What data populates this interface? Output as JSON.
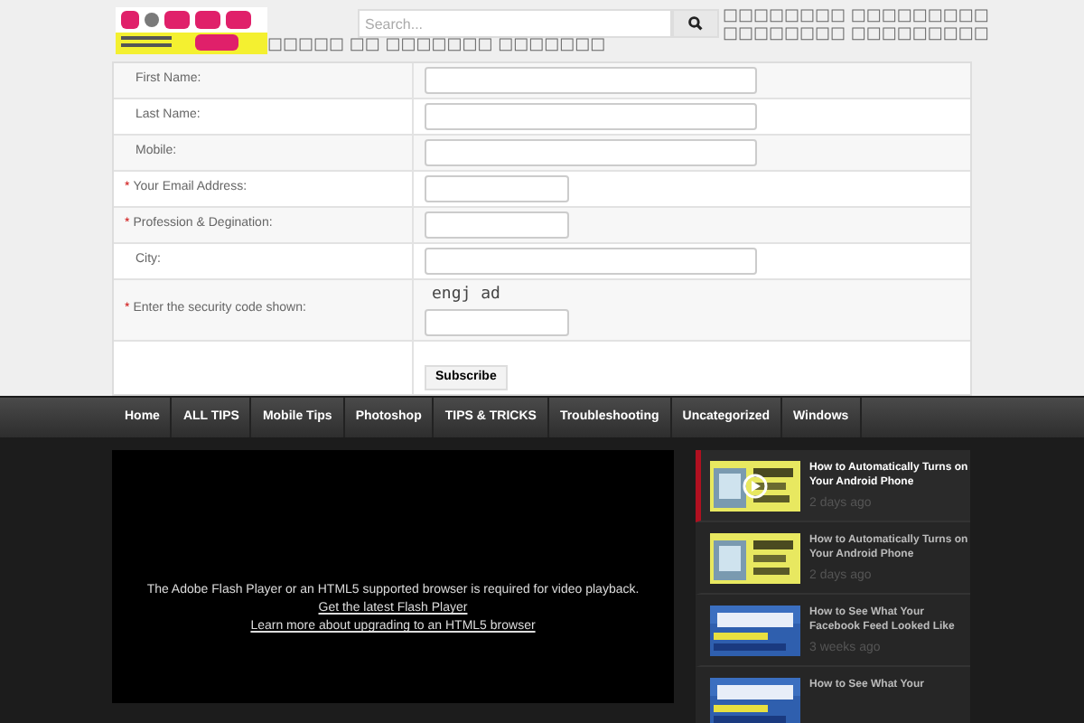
{
  "header": {
    "search": {
      "placeholder": "Search..."
    },
    "top_links": [
      "□□□□□□□□ □□□□□□□□□",
      "□□□□□□□□ □□□□□□□□□"
    ],
    "tagline": "□□□□□ □□ □□□□□□□ □□□□□□□"
  },
  "form": {
    "fields": [
      {
        "label": "First Name:",
        "required": false,
        "kind": "wide"
      },
      {
        "label": "Last Name:",
        "required": false,
        "kind": "wide"
      },
      {
        "label": "Mobile:",
        "required": false,
        "kind": "wide"
      },
      {
        "label": "Your Email Address:",
        "required": true,
        "kind": "short"
      },
      {
        "label": "Profession & Degination:",
        "required": true,
        "kind": "short"
      },
      {
        "label": "City:",
        "required": false,
        "kind": "wide"
      },
      {
        "label": "Enter the security code shown:",
        "required": true,
        "kind": "captcha",
        "code": "engj ad"
      }
    ],
    "required_mark": "*",
    "submit": "Subscribe"
  },
  "nav": [
    "Home",
    "ALL TIPS",
    "Mobile Tips",
    "Photoshop",
    "TIPS & TRICKS",
    "Troubleshooting",
    "Uncategorized",
    "Windows"
  ],
  "video": {
    "message": "The Adobe Flash Player or an HTML5 supported browser is required for video playback.",
    "links": [
      "Get the latest Flash Player",
      "Learn more about upgrading to an HTML5 browser"
    ]
  },
  "playlist": [
    {
      "title": "How to Automatically Turns on Your Android Phone",
      "time": "2 days ago",
      "selected": true,
      "kind": "android"
    },
    {
      "title": "How to Automatically Turns on Your Android Phone",
      "time": "2 days ago",
      "selected": false,
      "kind": "android"
    },
    {
      "title": "How to See What Your Facebook Feed Looked Like",
      "time": "3 weeks ago",
      "selected": false,
      "kind": "facebook"
    },
    {
      "title": "How to See What Your",
      "selected": false,
      "kind": "facebook"
    }
  ]
}
